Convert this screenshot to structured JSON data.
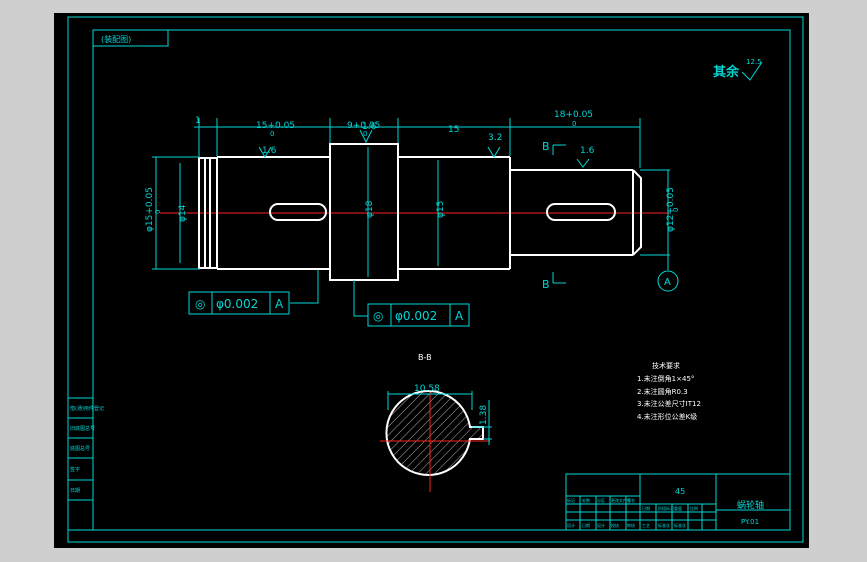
{
  "drawing": {
    "stamp_top_left": "(装配图)",
    "roughness_top_right": "其余",
    "roughness_value_top_right": "12.5",
    "dims": {
      "dim_1": "1",
      "tol_15": "15+0.05",
      "tol_15_lower": "0",
      "tol_9": "9+0.05",
      "tol_9_lower": "0",
      "dim_15_plain": "15",
      "tol_18": "18+0.05",
      "tol_18_lower": "0",
      "rough_16_a": "1.6",
      "rough_32": "3.2",
      "rough_16_b": "1.6",
      "rough_16_c": "1.6",
      "dia_left_tol": "φ15+0.05",
      "dia_left_tol_lower": "0",
      "dia_14": "φ14",
      "dia_18": "φ18",
      "dia_15": "φ15",
      "dia_right_tol": "φ12+0.05",
      "dia_right_tol_lower": "0"
    },
    "section_marks": {
      "top": "B",
      "bottom": "B"
    },
    "datum_label": "A",
    "tol_frame_1": {
      "symbol": "◎",
      "value": "φ0.002",
      "datum": "A"
    },
    "tol_frame_2": {
      "symbol": "◎",
      "value": "φ0.002",
      "datum": "A"
    },
    "section": {
      "title": "B-B",
      "width_dim": "10.58",
      "depth_dim": "1.38"
    },
    "notes": {
      "title": "技术要求",
      "items": [
        "1.未注倒角1×45°",
        "2.未注圆角R0.3",
        "3.未注公差尺寸IT12",
        "4.未注形位公差K级"
      ]
    },
    "title_block": {
      "material": "45",
      "part_name": "蜗轮轴",
      "drawing_no": "PY.01",
      "left_cells": [
        "设计",
        "校核",
        "审核",
        "工艺",
        "标准化",
        "日期"
      ],
      "bottom_cells": [
        "标记",
        "处数",
        "分区",
        "更改文件号",
        "签名",
        "日期",
        "设计",
        "标准化",
        "阶段标记",
        "重量",
        "比例"
      ]
    },
    "side_strip": [
      "借(通)用件登记",
      "旧底图总号",
      "底图总号",
      "签字",
      "日期"
    ]
  },
  "colors": {
    "background": "#000000",
    "frame": "#00d6d6",
    "part": "#ffffff",
    "centerline": "#ff2020",
    "section_hatch": "#ffffff"
  }
}
